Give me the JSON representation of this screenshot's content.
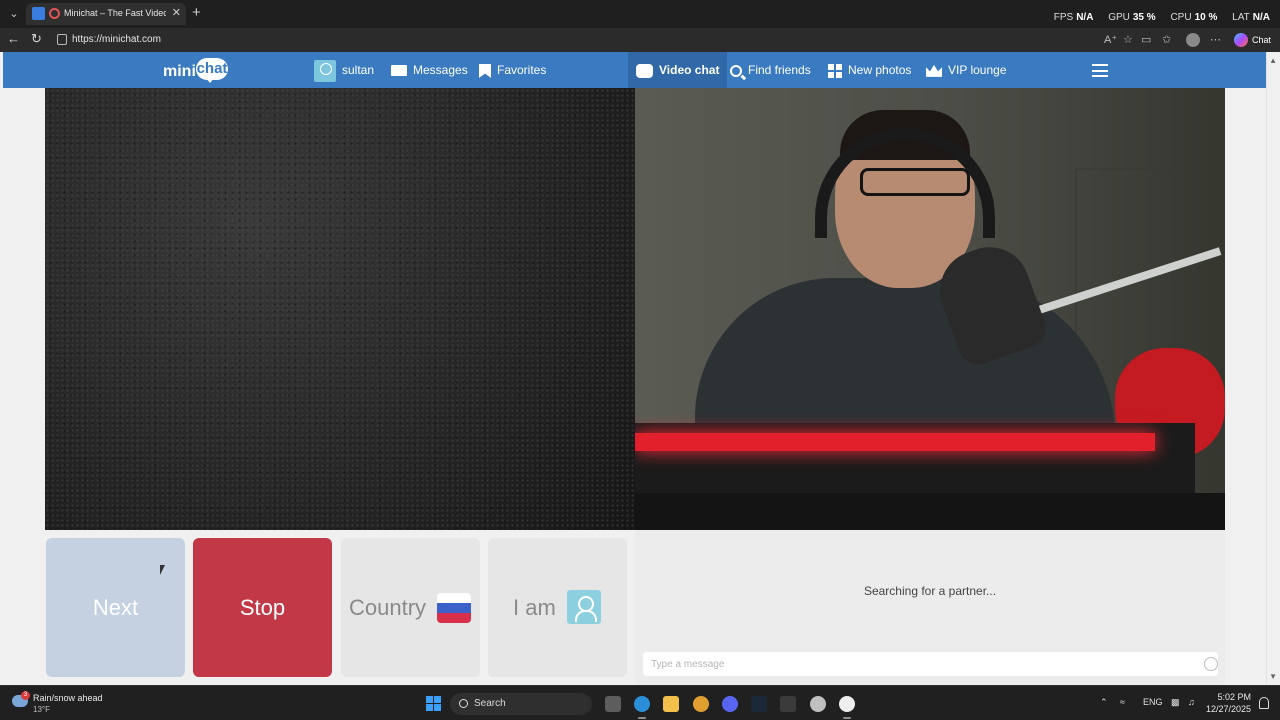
{
  "browser": {
    "tab_title": "Minichat – The Fast Video Ch",
    "url": "https://minichat.com",
    "copilot_label": "Chat",
    "perf": [
      {
        "label": "FPS",
        "value": "N/A"
      },
      {
        "label": "GPU",
        "value": "35 %"
      },
      {
        "label": "CPU",
        "value": "10 %"
      },
      {
        "label": "LAT",
        "value": "N/A"
      }
    ]
  },
  "site": {
    "logo_mini": "mini",
    "logo_chat": "chat",
    "nav": {
      "username": "sultan",
      "messages": "Messages",
      "favorites": "Favorites",
      "video_chat": "Video chat",
      "find_friends": "Find friends",
      "new_photos": "New photos",
      "vip_lounge": "VIP lounge"
    },
    "controls": {
      "next": "Next",
      "stop": "Stop",
      "country": "Country",
      "iam": "I am"
    },
    "chat": {
      "status": "Searching for a partner...",
      "input_placeholder": "Type a message"
    },
    "colors": {
      "nav_bg": "#3a7ac0",
      "next_bg": "#c5d1e0",
      "stop_bg": "#c23847"
    }
  },
  "taskbar": {
    "weather_title": "Rain/snow ahead",
    "weather_temp": "13°F",
    "weather_badge": "3",
    "search_label": "Search",
    "lang": "ENG",
    "time": "5:02 PM",
    "date": "12/27/2025"
  }
}
